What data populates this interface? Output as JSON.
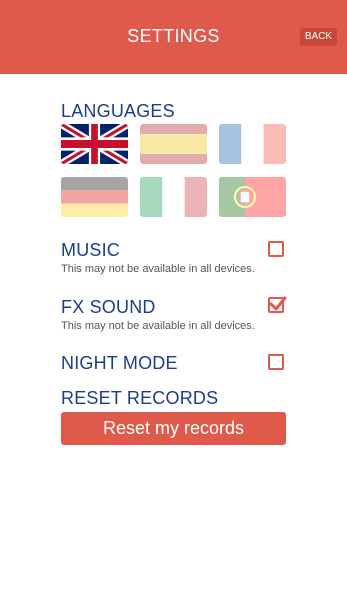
{
  "header": {
    "title": "SETTINGS",
    "back_label": "BACK"
  },
  "colors": {
    "accent": "#e05a4b",
    "accent_dark": "#c74739",
    "label": "#1c3d8c"
  },
  "languages": {
    "label": "LANGUAGES",
    "flags": [
      {
        "name": "uk-flag-icon",
        "selected": true
      },
      {
        "name": "spain-flag-icon",
        "selected": false
      },
      {
        "name": "france-flag-icon",
        "selected": false
      },
      {
        "name": "germany-flag-icon",
        "selected": false
      },
      {
        "name": "italy-flag-icon",
        "selected": false
      },
      {
        "name": "portugal-flag-icon",
        "selected": false
      }
    ]
  },
  "music": {
    "label": "MUSIC",
    "note": "This may not be available in all devices.",
    "checked": false
  },
  "fx_sound": {
    "label": "FX SOUND",
    "note": "This may not be available in all devices.",
    "checked": true
  },
  "night_mode": {
    "label": "NIGHT MODE",
    "checked": false
  },
  "reset": {
    "label": "RESET RECORDS",
    "button_label": "Reset my records"
  }
}
